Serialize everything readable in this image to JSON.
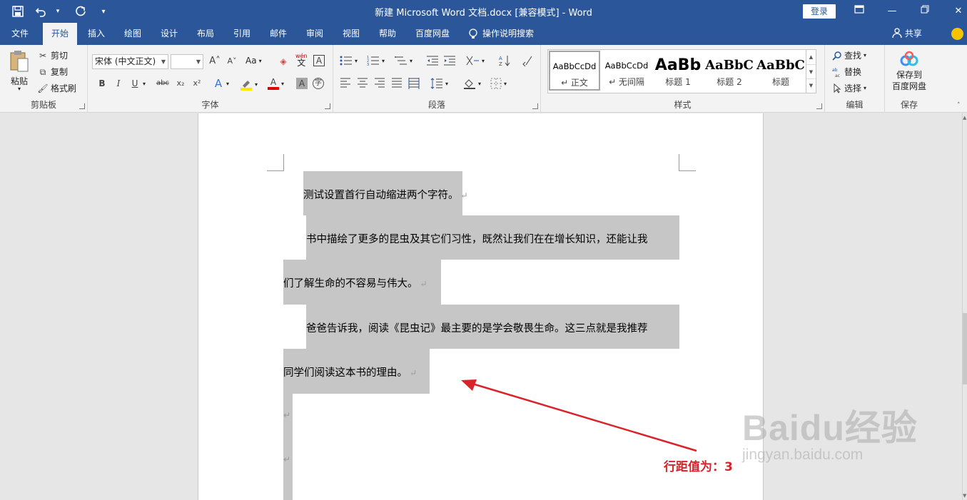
{
  "window": {
    "title": "新建 Microsoft Word 文档.docx [兼容模式]  -  Word",
    "login_label": "登录"
  },
  "tabs": [
    "文件",
    "开始",
    "插入",
    "绘图",
    "设计",
    "布局",
    "引用",
    "邮件",
    "审阅",
    "视图",
    "帮助",
    "百度网盘"
  ],
  "tell_me": "操作说明搜索",
  "share_label": "共享",
  "clipboard": {
    "paste": "粘贴",
    "cut": "剪切",
    "copy": "复制",
    "format_painter": "格式刷",
    "group_label": "剪贴板"
  },
  "font": {
    "name": "宋体 (中文正文)",
    "size": "",
    "group_label": "字体",
    "aa_label": "Aa",
    "wen": "wén",
    "wen_zh": "文"
  },
  "paragraph": {
    "group_label": "段落"
  },
  "styles": {
    "group_label": "样式",
    "items": [
      {
        "preview": "AaBbCcDd",
        "name": "↵ 正文"
      },
      {
        "preview": "AaBbCcDd",
        "name": "↵ 无间隔"
      },
      {
        "preview": "AaBb",
        "name": "标题 1"
      },
      {
        "preview": "AaBbC",
        "name": "标题 2"
      },
      {
        "preview": "AaBbC",
        "name": "标题"
      }
    ]
  },
  "editing": {
    "find": "查找",
    "replace": "替换",
    "select": "选择",
    "group_label": "编辑"
  },
  "save": {
    "label_line1": "保存到",
    "label_line2": "百度网盘",
    "group_label": "保存"
  },
  "document": {
    "lines": [
      "测试设置首行自动缩进两个字符。",
      "书中描绘了更多的昆虫及其它们习性，既然让我们在在增长知识，还能让我",
      "们了解生命的不容易与伟大。",
      "爸爸告诉我，阅读《昆虫记》最主要的是学会敬畏生命。这三点就是我推荐",
      "同学们阅读这本书的理由。"
    ],
    "paragraph_mark": "↵"
  },
  "annotation": {
    "text": "行距值为：3",
    "color": "#d9232a"
  },
  "watermark": {
    "top": "Baidu经验",
    "bottom": "jingyan.baidu.com"
  },
  "colors": {
    "accent": "#2b579a",
    "selection": "#c6c6c6"
  }
}
